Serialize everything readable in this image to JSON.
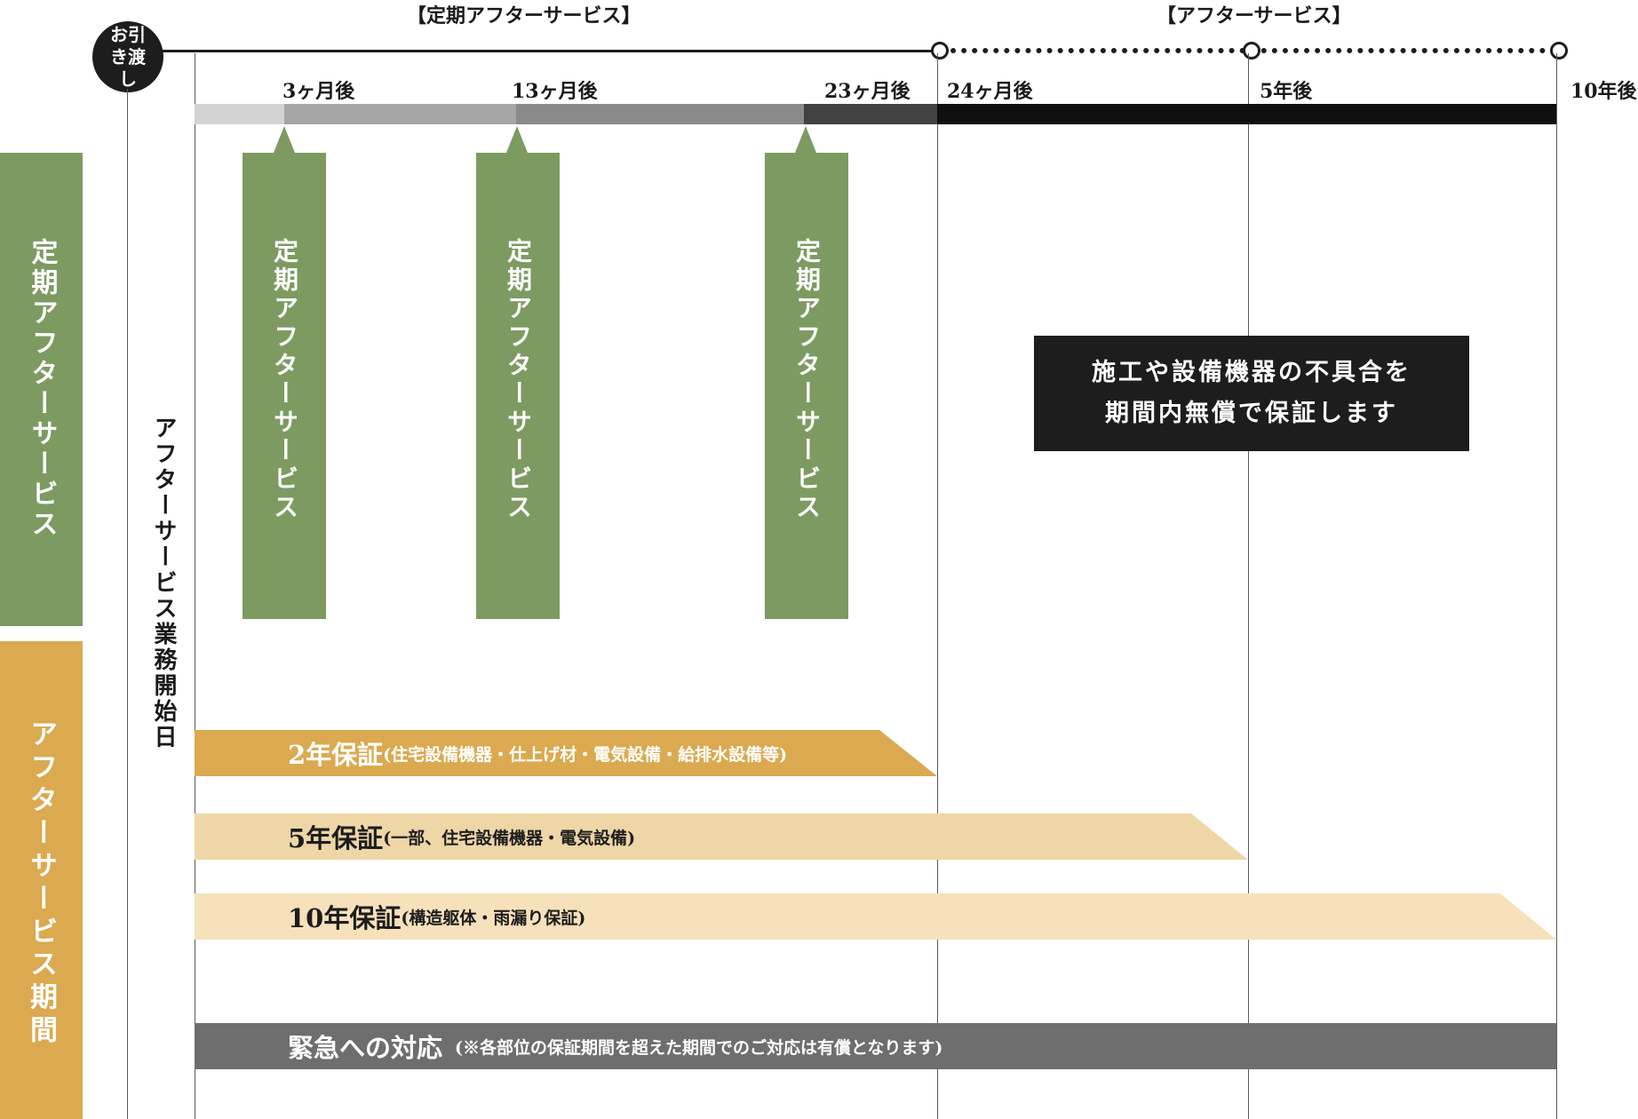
{
  "header": {
    "handover_label": "お引き渡し",
    "regular_service_header": "【定期アフターサービス】",
    "after_service_header": "【アフターサービス】"
  },
  "timeline": {
    "ticks": [
      "3ヶ月後",
      "13ヶ月後",
      "23ヶ月後",
      "24ヶ月後",
      "5年後",
      "10年後"
    ]
  },
  "side_labels": {
    "regular": "定期アフターサービス",
    "period": "アフターサービス期間",
    "start_day": "アフターサービス業務開始日"
  },
  "inspections": [
    {
      "label": "定期アフターサービス"
    },
    {
      "label": "定期アフターサービス"
    },
    {
      "label": "定期アフターサービス"
    }
  ],
  "guarantee_box": {
    "line1": "施工や設備機器の不具合を",
    "line2": "期間内無償で保証します"
  },
  "warranties": [
    {
      "title": "2年保証",
      "detail": "(住宅設備機器・仕上げ材・電気設備・給排水設備等)",
      "color": "#dba94f"
    },
    {
      "title": "5年保証",
      "detail": "(一部、住宅設備機器・電気設備)",
      "color": "#efd6a6"
    },
    {
      "title": "10年保証",
      "detail": "(構造躯体・雨漏り保証)",
      "color": "#f6e1bb"
    }
  ],
  "emergency": {
    "title": "緊急への対応",
    "detail": "(※各部位の保証期間を超えた期間でのご対応は有償となります)",
    "color": "#6e6e6e"
  },
  "colors": {
    "green": "#7d9a61",
    "gold": "#dba94f",
    "black": "#1d1d1d"
  }
}
